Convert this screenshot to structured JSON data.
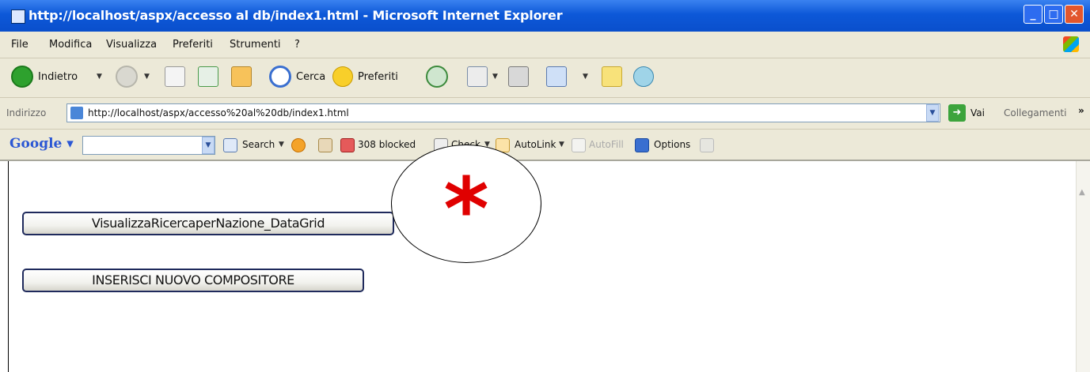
{
  "window": {
    "title": "http://localhost/aspx/accesso al db/index1.html - Microsoft Internet Explorer"
  },
  "menu": [
    "File",
    "Modifica",
    "Visualizza",
    "Preferiti",
    "Strumenti",
    "?"
  ],
  "toolbar": {
    "back_label": "Indietro",
    "search_label": "Cerca",
    "favorites_label": "Preferiti"
  },
  "address": {
    "label": "Indirizzo",
    "url": "http://localhost/aspx/accesso%20al%20db/index1.html",
    "go_label": "Vai",
    "links_label": "Collegamenti"
  },
  "googlebar": {
    "logo": "Google",
    "search_label": "Search",
    "blocked_label": "308 blocked",
    "check_label": "Check",
    "autolink_label": "AutoLink",
    "autofill_label": "AutoFill",
    "options_label": "Options"
  },
  "page": {
    "buttons": [
      "VisualizzaRicercaperNazione_DataGrid",
      "INSERISCI NUOVO COMPOSITORE"
    ],
    "marker": "*"
  },
  "colors": {
    "titlebar": "#0d58d8",
    "chrome": "#ece9d8",
    "marker": "#e00000"
  }
}
